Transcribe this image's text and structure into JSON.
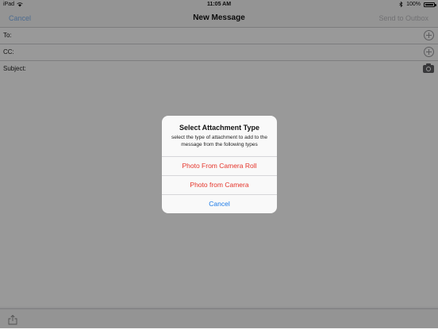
{
  "status_bar": {
    "carrier": "iPad",
    "time": "11:05 AM",
    "battery": "100%"
  },
  "nav": {
    "cancel_label": "Cancel",
    "title": "New Message",
    "send_label": "Send to Outbox"
  },
  "fields": {
    "to_label": "To:",
    "cc_label": "CC:",
    "subject_label": "Subject:"
  },
  "alert": {
    "title": "Select Attachment Type",
    "message": "select the type of attachment to add to the message from the following types",
    "actions": [
      "Photo From Camera Roll",
      "Photo from Camera",
      "Cancel"
    ]
  },
  "icons": [
    "wifi-icon",
    "bluetooth-icon",
    "battery-icon",
    "add-contact-icon",
    "camera-icon",
    "share-icon"
  ],
  "colors": {
    "destructive": "#e5342a",
    "accent": "#1a7ae8",
    "disabled": "#bcbcc0"
  }
}
